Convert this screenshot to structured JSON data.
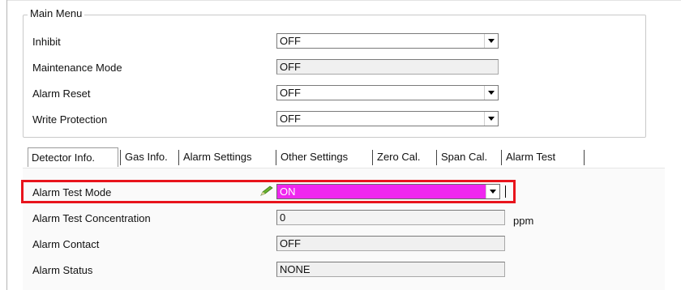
{
  "main_menu": {
    "title": "Main Menu",
    "inhibit": {
      "label": "Inhibit",
      "value": "OFF"
    },
    "maintenance_mode": {
      "label": "Maintenance Mode",
      "value": "OFF"
    },
    "alarm_reset": {
      "label": "Alarm Reset",
      "value": "OFF"
    },
    "write_protection": {
      "label": "Write Protection",
      "value": "OFF"
    }
  },
  "tabs": [
    {
      "label": "Detector Info."
    },
    {
      "label": "Gas Info."
    },
    {
      "label": "Alarm Settings"
    },
    {
      "label": "Other Settings"
    },
    {
      "label": "Zero Cal."
    },
    {
      "label": "Span Cal."
    },
    {
      "label": "Alarm Test"
    }
  ],
  "alarm_test": {
    "mode": {
      "label": "Alarm Test Mode",
      "value": "ON"
    },
    "concentration": {
      "label": "Alarm Test Concentration",
      "value": "0",
      "unit": "ppm"
    },
    "contact": {
      "label": "Alarm Contact",
      "value": "OFF"
    },
    "status": {
      "label": "Alarm Status",
      "value": "NONE"
    }
  },
  "colors": {
    "highlight_border": "#e8141c",
    "on_field_background": "#ef27ef",
    "pencil_icon": "#6ab32e"
  },
  "icons": {
    "edit": "pencil-icon",
    "dropdown": "chevron-down-icon"
  }
}
